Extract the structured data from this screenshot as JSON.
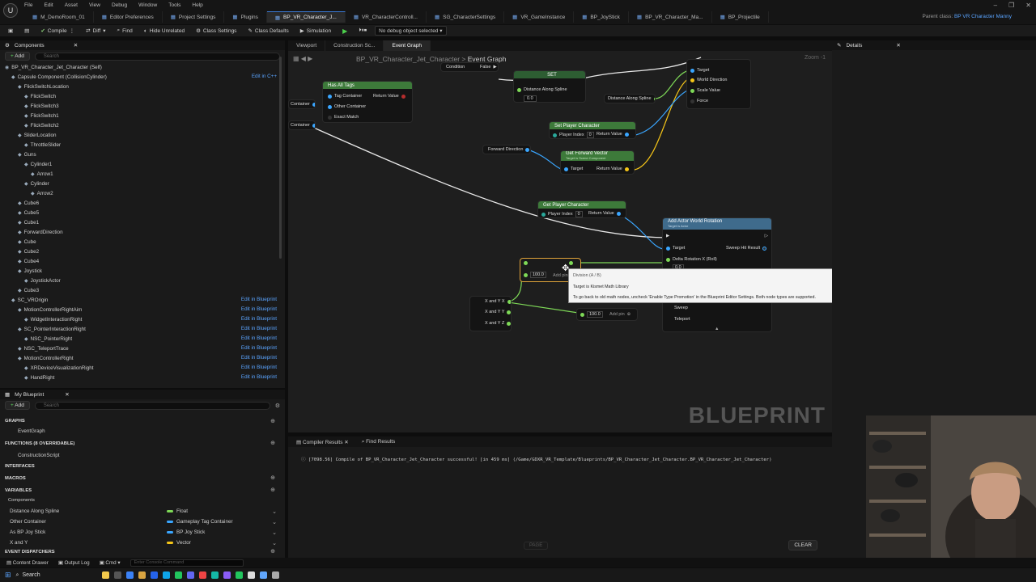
{
  "menu": [
    "File",
    "Edit",
    "Asset",
    "View",
    "Debug",
    "Window",
    "Tools",
    "Help"
  ],
  "file_tabs": [
    {
      "label": "M_DemoRoom_01",
      "active": false
    },
    {
      "label": "Editor Preferences",
      "active": false
    },
    {
      "label": "Project Settings",
      "active": false
    },
    {
      "label": "Plugins",
      "active": false
    },
    {
      "label": "BP_VR_Character_J...",
      "active": true
    },
    {
      "label": "VR_CharacterControll...",
      "active": false
    },
    {
      "label": "SG_CharacterSettings",
      "active": false
    },
    {
      "label": "VR_GameInstance",
      "active": false
    },
    {
      "label": "BP_JoyStick",
      "active": false
    },
    {
      "label": "BP_VR_Character_Ma...",
      "active": false
    },
    {
      "label": "BP_Projectile",
      "active": false
    }
  ],
  "parent_class": {
    "label": "Parent class:",
    "value": "BP VR Character Manny"
  },
  "toolbar": {
    "compile": "Compile",
    "diff": "Diff",
    "find": "Find",
    "hide_unrelated": "Hide Unrelated",
    "class_settings": "Class Settings",
    "class_defaults": "Class Defaults",
    "simulation": "Simulation",
    "debug_select": "No debug object selected"
  },
  "components_panel": {
    "title": "Components",
    "add": "Add",
    "search_placeholder": "Search",
    "items": [
      {
        "label": "BP_VR_Character_Jet_Character (Self)",
        "indent": 0,
        "edit": ""
      },
      {
        "label": "Capsule Component (CollisionCylinder)",
        "indent": 1,
        "edit": "Edit in C++"
      },
      {
        "label": "FlickSwitchLocation",
        "indent": 2,
        "edit": ""
      },
      {
        "label": "FlickSwitch",
        "indent": 3,
        "edit": ""
      },
      {
        "label": "FlickSwitch3",
        "indent": 3,
        "edit": ""
      },
      {
        "label": "FlickSwitch1",
        "indent": 3,
        "edit": ""
      },
      {
        "label": "FlickSwitch2",
        "indent": 3,
        "edit": ""
      },
      {
        "label": "SliderLocation",
        "indent": 2,
        "edit": ""
      },
      {
        "label": "ThrottleSlider",
        "indent": 3,
        "edit": ""
      },
      {
        "label": "Guns",
        "indent": 2,
        "edit": ""
      },
      {
        "label": "Cylinder1",
        "indent": 3,
        "edit": ""
      },
      {
        "label": "Arrow1",
        "indent": 4,
        "edit": ""
      },
      {
        "label": "Cylinder",
        "indent": 3,
        "edit": ""
      },
      {
        "label": "Arrow2",
        "indent": 4,
        "edit": ""
      },
      {
        "label": "Cube6",
        "indent": 2,
        "edit": ""
      },
      {
        "label": "Cube5",
        "indent": 2,
        "edit": ""
      },
      {
        "label": "Cube1",
        "indent": 2,
        "edit": ""
      },
      {
        "label": "ForwardDirection",
        "indent": 2,
        "edit": ""
      },
      {
        "label": "Cube",
        "indent": 2,
        "edit": ""
      },
      {
        "label": "Cube2",
        "indent": 2,
        "edit": ""
      },
      {
        "label": "Cube4",
        "indent": 2,
        "edit": ""
      },
      {
        "label": "Joystick",
        "indent": 2,
        "edit": ""
      },
      {
        "label": "JoystickActor",
        "indent": 3,
        "edit": ""
      },
      {
        "label": "Cube3",
        "indent": 2,
        "edit": ""
      },
      {
        "label": "SC_VROrigin",
        "indent": 1,
        "edit": "Edit in Blueprint"
      },
      {
        "label": "MotionControllerRightAim",
        "indent": 2,
        "edit": "Edit in Blueprint"
      },
      {
        "label": "WidgetInteractionRight",
        "indent": 3,
        "edit": "Edit in Blueprint"
      },
      {
        "label": "SC_PointerInteractionRight",
        "indent": 2,
        "edit": "Edit in Blueprint"
      },
      {
        "label": "NSC_PointerRight",
        "indent": 3,
        "edit": "Edit in Blueprint"
      },
      {
        "label": "NSC_TeleportTrace",
        "indent": 2,
        "edit": "Edit in Blueprint"
      },
      {
        "label": "MotionControllerRight",
        "indent": 2,
        "edit": "Edit in Blueprint"
      },
      {
        "label": "XRDeviceVisualizationRight",
        "indent": 3,
        "edit": "Edit in Blueprint"
      },
      {
        "label": "HandRight",
        "indent": 3,
        "edit": "Edit in Blueprint"
      }
    ]
  },
  "my_blueprint": {
    "title": "My Blueprint",
    "add": "Add",
    "search_placeholder": "Search",
    "graphs": "GRAPHS",
    "event_graph": "EventGraph",
    "functions": "FUNCTIONS (8 OVERRIDABLE)",
    "construction_script": "ConstructionScript",
    "interfaces": "INTERFACES",
    "macros": "MACROS",
    "variables": "VARIABLES",
    "components": "Components",
    "vars": [
      {
        "name": "Distance Along Spline",
        "type": "Float",
        "color": "#7ed957"
      },
      {
        "name": "Other Container",
        "type": "Gameplay Tag Container",
        "color": "#3aa6ff"
      },
      {
        "name": "As BP Joy Stick",
        "type": "BP Joy Stick",
        "color": "#3aa6ff"
      },
      {
        "name": "X and Y",
        "type": "Vector",
        "color": "#f5c518"
      }
    ],
    "event_dispatchers": "EVENT DISPATCHERS"
  },
  "graph_tabs": [
    {
      "label": "Viewport",
      "active": false
    },
    {
      "label": "Construction Sc...",
      "active": false
    },
    {
      "label": "Event Graph",
      "active": true
    }
  ],
  "graph": {
    "breadcrumb": "BP_VR_Character_Jet_Character",
    "breadcrumb_current": "Event Graph",
    "zoom": "Zoom -1",
    "watermark": "BLUEPRINT",
    "nodes": {
      "has_all_tags": "Has All Tags",
      "tag_container": "Tag Container",
      "other_container": "Other Container",
      "exact_match": "Exact Match",
      "return_value": "Return Value",
      "container": "Container",
      "condition": "Condition",
      "false": "False",
      "set": "SET",
      "distance_along_spline": "Distance Along Spline",
      "dist_value": "0.0",
      "set_player_character": "Set Player Character",
      "player_index": "Player Index",
      "pidx_value": "0",
      "forward_direction": "Forward Direction",
      "get_forward_vector": "Get Forward Vector",
      "get_forward_sub": "Target is Scene Component",
      "target": "Target",
      "get_player_character": "Get Player Character",
      "add_actor_world_rotation": "Add Actor World Rotation",
      "add_actor_sub": "Target is Actor",
      "sweep_hit_result": "Sweep Hit Result",
      "delta_rotation": "Delta Rotation X (Roll)",
      "delta_value": "0.0",
      "sweep": "Sweep",
      "teleport": "Teleport",
      "world_direction": "World Direction",
      "scale_value": "Scale Value",
      "force": "Force",
      "div_value": "100.0",
      "add_pin": "Add pin",
      "x_and_y_x": "X and Y X",
      "x_and_y_y": "X and Y Y",
      "x_and_y_z": "X and Y Z",
      "div2_value": "100.0"
    },
    "tooltip": {
      "title": "Division (A / B)",
      "line1": "Target is Kismet Math Library",
      "line2": "To go back to old math nodes, uncheck 'Enable Type Promotion' in the Blueprint Editor Settings. Both node types are supported."
    }
  },
  "results": {
    "tab1": "Compiler Results",
    "tab2": "Find Results",
    "line": "[7098.56] Compile of BP_VR_Character_Jet_Character successful! [in 459 ms] (/Game/GDXR_VR_Template/Blueprints/BP_VR_Character_Jet_Character.BP_VR_Character_Jet_Character)",
    "page": "PAGE",
    "clear": "CLEAR"
  },
  "details": {
    "title": "Details"
  },
  "statusbar": {
    "content_drawer": "Content Drawer",
    "output_log": "Output Log",
    "cmd": "Cmd",
    "cmd_placeholder": "Enter Console Command"
  },
  "taskbar": {
    "search": "Search"
  }
}
